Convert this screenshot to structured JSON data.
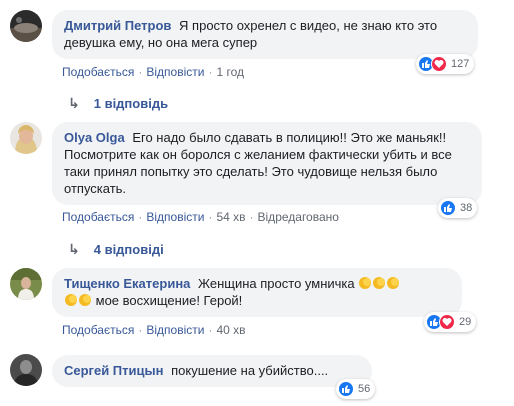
{
  "comments": [
    {
      "author": "Дмитрий Петров",
      "text": "Я просто охренел с видео, не знаю кто это девушка ему, но она мега супер",
      "actions": {
        "like": "Подобається",
        "reply": "Відповісти",
        "time": "1 год",
        "extra": ""
      },
      "reactions": "127",
      "replies": "1 відповідь"
    },
    {
      "author": "Olya Olga",
      "text": "Его надо было сдавать в полицию!! Это же маньяк!! Посмотрите как он боролся с желанием фактически убить и все таки принял попытку это сделать! Это чудовище нельзя было отпускать.",
      "actions": {
        "like": "Подобається",
        "reply": "Відповісти",
        "time": "54 хв",
        "extra": "Відредаговано"
      },
      "reactions": "38",
      "replies": "4 відповіді"
    },
    {
      "author": "Тищенко Екатерина",
      "text": "Женщина просто умничка",
      "text2": "мое восхищение! Герой!",
      "actions": {
        "like": "Подобається",
        "reply": "Відповісти",
        "time": "40 хв",
        "extra": ""
      },
      "reactions": "29"
    },
    {
      "author": "Сергей Птицын",
      "text": "покушение на убийство....",
      "reactions": "56"
    }
  ],
  "icons": {
    "like": "like-icon",
    "love": "heart-icon",
    "reply_arrow": "reply-arrow-icon",
    "clap": "clapping-hands-icon"
  },
  "colors": {
    "link": "#385898",
    "bubble": "#f2f3f5",
    "like": "#1877f2",
    "love": "#f0284a",
    "meta": "#616770"
  }
}
